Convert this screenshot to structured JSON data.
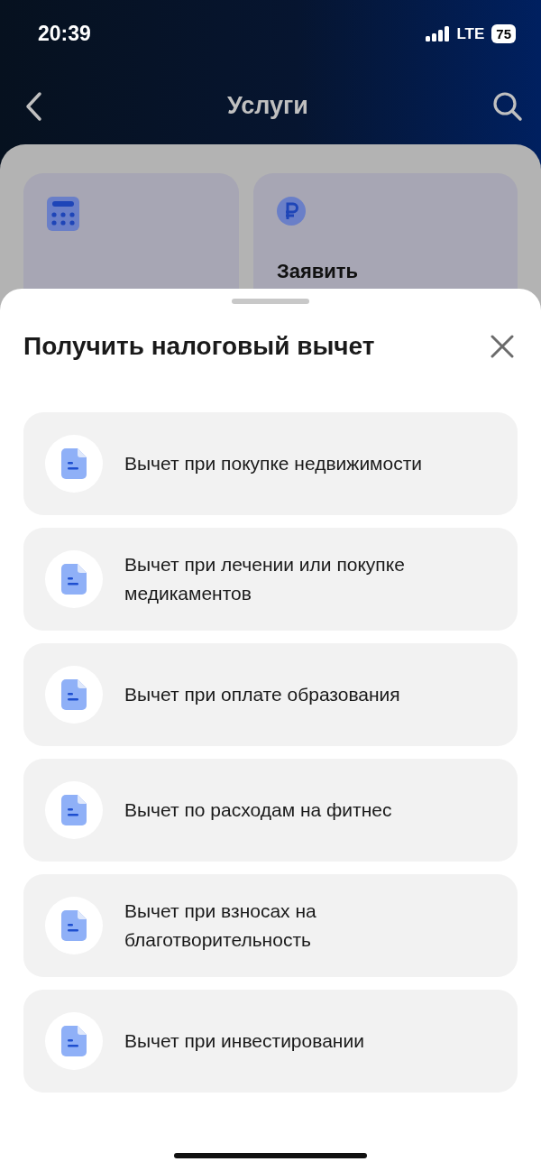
{
  "status_bar": {
    "time": "20:39",
    "network": "LTE",
    "battery": "75"
  },
  "nav": {
    "title": "Услуги"
  },
  "background_cards": [
    {
      "kind": "calculator"
    },
    {
      "kind": "ruble",
      "label": "Заявить"
    }
  ],
  "sheet": {
    "title": "Получить налоговый вычет",
    "items": [
      {
        "label": "Вычет при покупке недвижимости"
      },
      {
        "label": "Вычет при лечении или покупке медикаментов"
      },
      {
        "label": "Вычет при оплате образования"
      },
      {
        "label": "Вычет по расходам на фитнес"
      },
      {
        "label": "Вычет при взносах на благотворительность"
      },
      {
        "label": "Вычет при инвестировании"
      }
    ]
  }
}
